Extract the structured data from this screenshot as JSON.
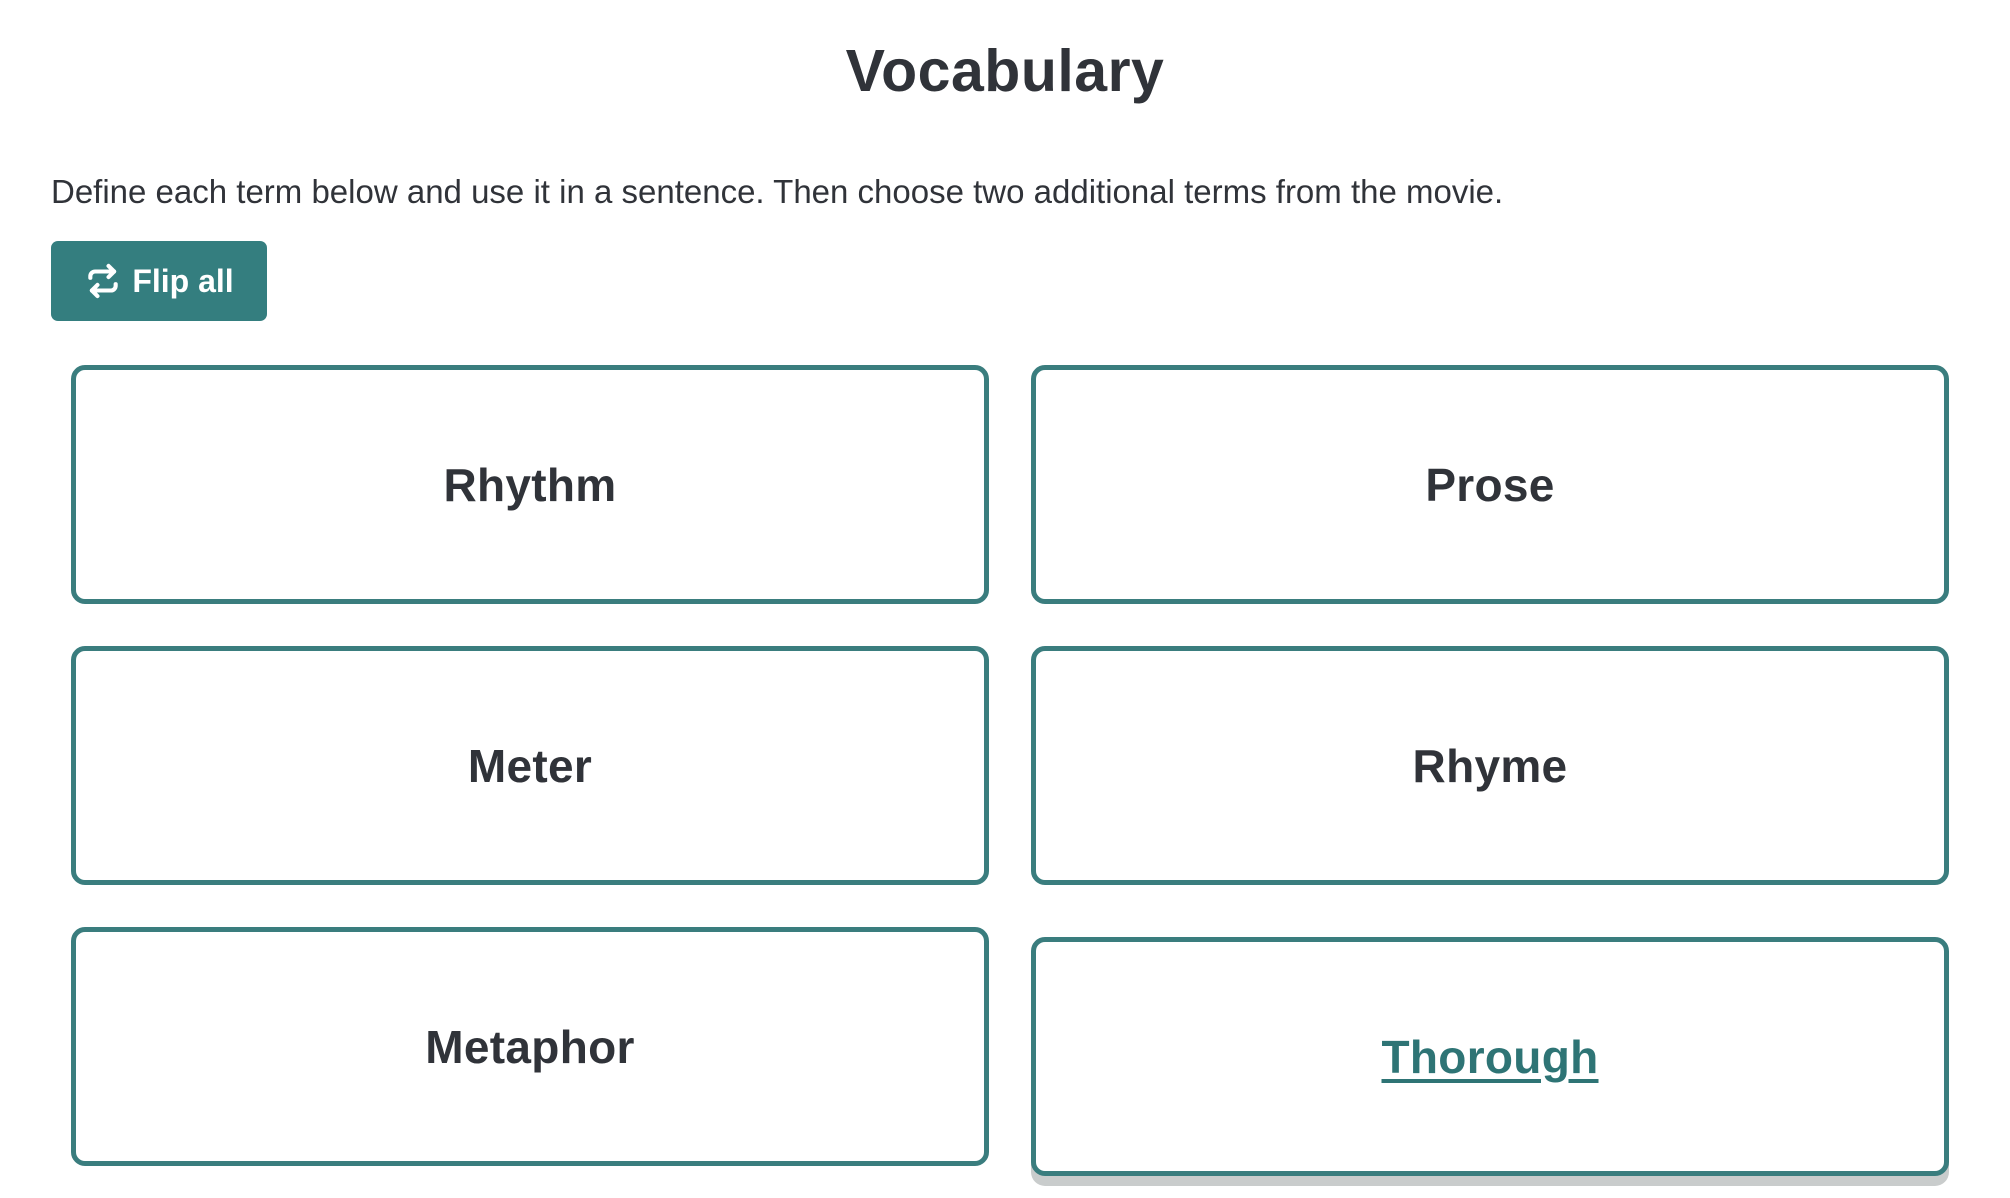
{
  "header": {
    "title": "Vocabulary"
  },
  "instructions": "Define each term below and use it in a sentence. Then choose two additional terms from the movie.",
  "toolbar": {
    "flip_all_label": "Flip all",
    "flip_all_icon": "flip-icon"
  },
  "colors": {
    "accent": "#347e7f",
    "card_border": "#3a7d7e",
    "text": "#303339"
  },
  "cards": [
    {
      "term": "Rhythm"
    },
    {
      "term": "Prose"
    },
    {
      "term": "Meter"
    },
    {
      "term": "Rhyme"
    },
    {
      "term": "Metaphor"
    },
    {
      "term": "Thorough",
      "focused": true
    }
  ]
}
